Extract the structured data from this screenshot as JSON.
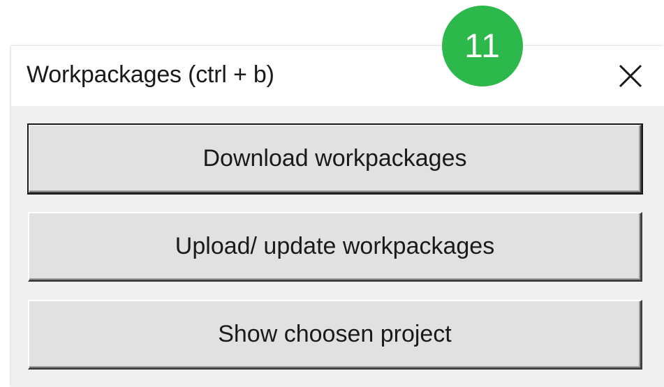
{
  "dialog": {
    "title": "Workpackages (ctrl + b)",
    "close_icon": "close-icon"
  },
  "buttons": {
    "download_label": "Download workpackages",
    "upload_label": "Upload/ update workpackages",
    "show_label": "Show choosen project"
  },
  "badge": {
    "number": "11",
    "color": "#2db84b"
  }
}
